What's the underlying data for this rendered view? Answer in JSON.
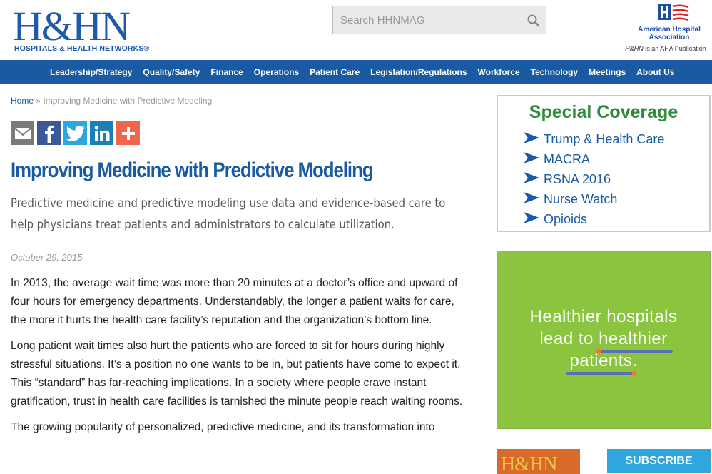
{
  "header": {
    "logo_main": "H&HN",
    "logo_sub": "HOSPITALS & HEALTH NETWORKS®",
    "search_placeholder": "Search HHNMAG",
    "aha_name": "American Hospital Association",
    "aha_publication_prefix": "H&HN",
    "aha_publication_suffix": " is an AHA Publication"
  },
  "nav": {
    "items": [
      "Leadership/Strategy",
      "Quality/Safety",
      "Finance",
      "Operations",
      "Patient Care",
      "Legislation/Regulations",
      "Workforce",
      "Technology",
      "Meetings",
      "About Us"
    ]
  },
  "breadcrumb": {
    "home": "Home",
    "separator": "»",
    "current": "Improving Medicine with Predictive Modeling"
  },
  "share": {
    "icons": [
      "email-icon",
      "facebook-icon",
      "twitter-icon",
      "linkedin-icon",
      "plus-icon"
    ],
    "colors": {
      "email": "#7a7a7a",
      "facebook": "#3b5998",
      "twitter": "#2fa6de",
      "linkedin": "#1b80b6",
      "more": "#f0654d"
    }
  },
  "article": {
    "title": "Improving Medicine with Predictive Modeling",
    "deck": "Predictive medicine and predictive modeling use data and evidence-based care to help physicians treat patients and administrators to calculate utilization.",
    "date": "October 29, 2015",
    "paragraphs": [
      "In 2013, the average wait time was more than 20 minutes at a doctor’s office and upward of four hours for emergency departments. Understandably, the longer a patient waits for care, the more it hurts the health care facility’s reputation and the organization’s bottom line.",
      "Long patient wait times also hurt the patients who are forced to sit for hours during highly stressful situations. It’s a position no one wants to be in, but patients have come to expect it. This “standard” has far-reaching implications. In a society where people crave instant gratification, trust in health care facilities is tarnished the minute people reach waiting rooms.",
      "The growing popularity of personalized, predictive medicine, and its transformation into"
    ]
  },
  "sidebar": {
    "special_title": "Special Coverage",
    "special_items": [
      "Trump & Health Care",
      "MACRA",
      "RSNA 2016",
      "Nurse Watch",
      "Opioids"
    ],
    "ad_lines": [
      "Healthier hospitals",
      "lead to healthier",
      "patients."
    ],
    "magazine_title": "H&HN",
    "subscribe": "SUBSCRIBE"
  },
  "colors": {
    "brand_blue": "#1a5aa2",
    "special_green": "#2e8b3c",
    "ad_green": "#8bc43f",
    "subscribe_blue": "#2fa6de"
  }
}
